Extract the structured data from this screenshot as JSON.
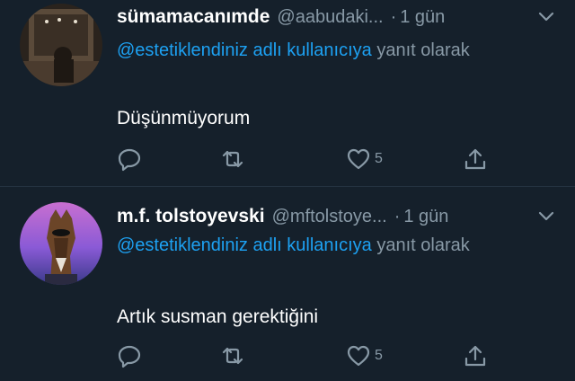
{
  "tweets": [
    {
      "display_name": "sümamacanımde",
      "handle": "@aabudaki...",
      "separator": "·",
      "time": "1 gün",
      "reply_mention": "@estetiklendiniz adlı kullanıcıya",
      "reply_suffix": " yanıt olarak",
      "text": "Düşünmüyorum",
      "like_count": "5"
    },
    {
      "display_name": "m.f. tolstoyevski",
      "handle": "@mftolstoye...",
      "separator": "·",
      "time": "1 gün",
      "reply_mention": "@estetiklendiniz adlı kullanıcıya",
      "reply_suffix": " yanıt olarak",
      "text": "Artık susman gerektiğini",
      "like_count": "5"
    }
  ],
  "colors": {
    "background": "#15202b",
    "link": "#1da1f2",
    "secondary": "#8899a6",
    "divider": "#253341"
  },
  "icons": [
    "reply-icon",
    "retweet-icon",
    "like-icon",
    "share-icon",
    "chevron-down-icon"
  ]
}
